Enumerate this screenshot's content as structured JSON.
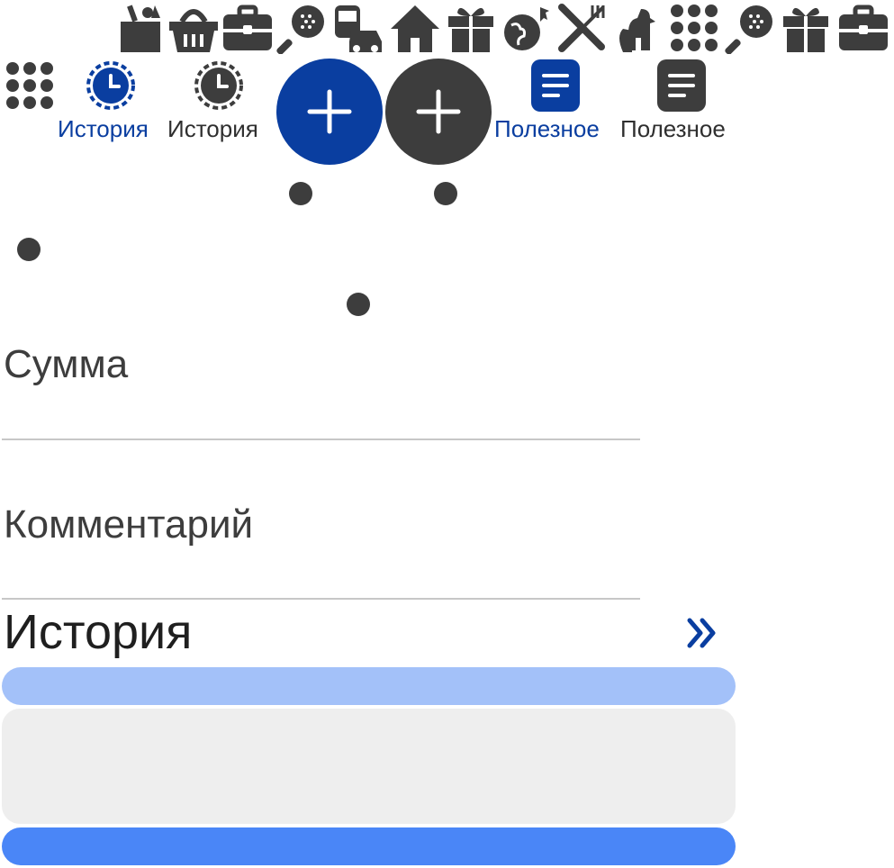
{
  "top_icons": [
    "grocery-bag-icon",
    "basket-icon",
    "briefcase-icon",
    "padel-racket-icon",
    "transport-icon",
    "home-icon",
    "gift-icon",
    "travel-globe-icon",
    "restaurant-icon",
    "pets-icon",
    "apps-grid-icon",
    "padel-racket-icon",
    "gift-icon",
    "briefcase-icon"
  ],
  "nav": {
    "history_active_label": "История",
    "history_label": "История",
    "useful_active_label": "Полезное",
    "useful_label": "Полезное"
  },
  "form": {
    "amount_label": "Сумма",
    "comment_label": "Комментарий"
  },
  "history": {
    "title": "История"
  },
  "colors": {
    "accent_blue": "#0a3ea0",
    "dark_gray": "#3d3d3d",
    "bar_light_blue": "#a3c1f9",
    "bar_blue": "#4a86f7",
    "card_gray": "#eeeeee"
  }
}
